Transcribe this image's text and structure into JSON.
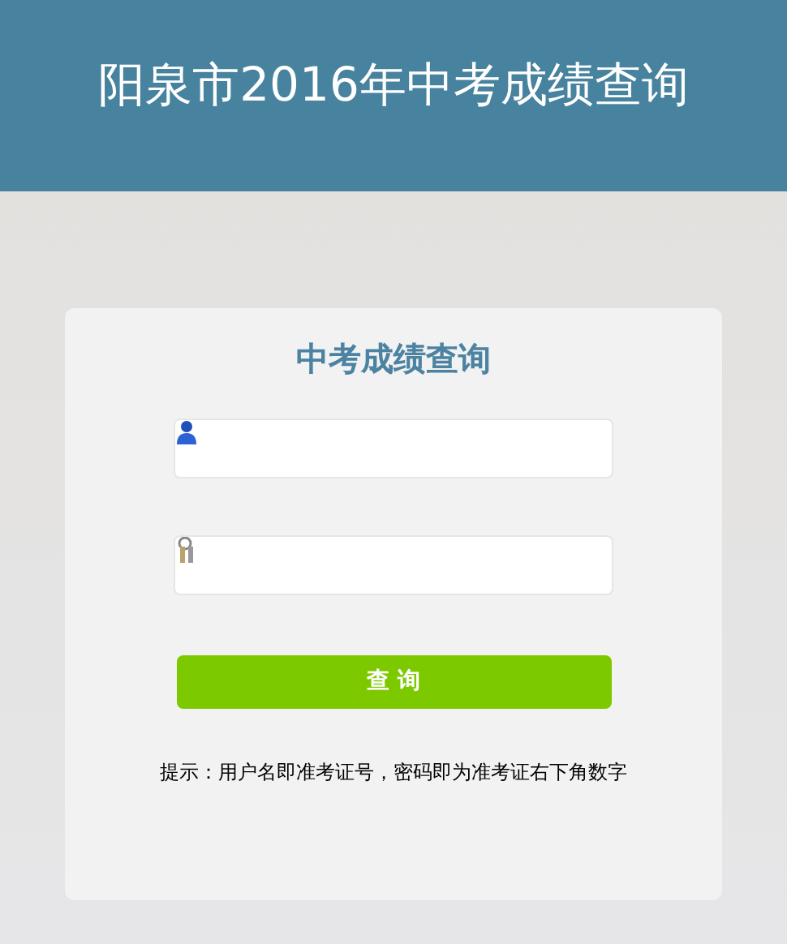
{
  "header": {
    "title": "阳泉市2016年中考成绩查询"
  },
  "form": {
    "title": "中考成绩查询",
    "fields": [
      {
        "kind": "user"
      },
      {
        "kind": "password"
      }
    ],
    "button": "查 询",
    "hint": "提示：用户名即准考证号，密码即为准考证右下角数字"
  }
}
